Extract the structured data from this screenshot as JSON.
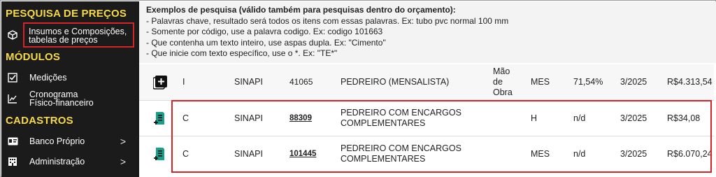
{
  "sidebar": {
    "section_pesquisa": "PESQUISA DE PREÇOS",
    "item_insumos": "Insumos e Composições, tabelas de preços",
    "section_modulos": "MÓDULOS",
    "item_medicoes": "Medições",
    "item_cronograma": "Cronograma Físico-financeiro",
    "section_cadastros": "CADASTROS",
    "item_banco": "Banco Próprio",
    "item_admin": "Administração",
    "chevron": ">"
  },
  "hint": {
    "title": "Exemplos de pesquisa (válido também para pesquisas dentro do orçamento):",
    "line1": "- Palavras chave, resultado será todos os itens com essas palavras. Ex: tubo pvc normal 100 mm",
    "line2": "- Somente por código, use a palavra codigo. Ex: codigo 101663",
    "line3": "- Que contenha um texto inteiro, use aspas dupla. Ex: \"Cimento\"",
    "line4": "- Que inicie com texto específico, use o *. Ex: \"TE*\""
  },
  "rows": [
    {
      "type": "I",
      "source": "SINAPI",
      "code": "41065",
      "description": "PEDREIRO (MENSALISTA)",
      "class": "Mão de Obra",
      "unit": "MES",
      "percent": "71,54%",
      "date": "3/2025",
      "price": "R$4.313,54",
      "icon": "add-icon"
    },
    {
      "type": "C",
      "source": "SINAPI",
      "code": "88309",
      "description": "PEDREIRO COM ENCARGOS COMPLEMENTARES",
      "class": "",
      "unit": "H",
      "percent": "n/d",
      "date": "3/2025",
      "price": "R$34,08",
      "icon": "composition-add-icon"
    },
    {
      "type": "C",
      "source": "SINAPI",
      "code": "101445",
      "description": "PEDREIRO COM ENCARGOS COMPLEMENTARES",
      "class": "",
      "unit": "MES",
      "percent": "n/d",
      "date": "3/2025",
      "price": "R$6.070,24",
      "icon": "composition-add-icon"
    }
  ],
  "colors": {
    "accent": "#f5d94a",
    "highlight": "#d8232a",
    "sidebar_bg": "#1b1b1b",
    "icon_teal": "#1aa08a"
  }
}
